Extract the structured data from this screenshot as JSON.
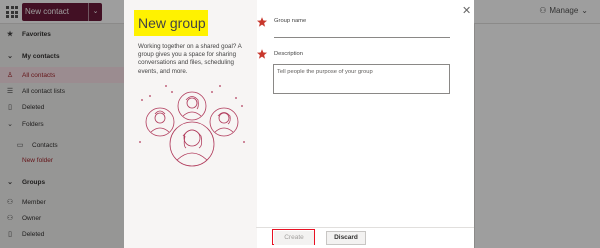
{
  "app": {
    "new_contact_label": "New contact",
    "manage_label": "Manage",
    "nav": {
      "favorites": "Favorites",
      "my_contacts": "My contacts",
      "all_contacts": "All contacts",
      "all_contact_lists": "All contact lists",
      "deleted": "Deleted",
      "folders": "Folders",
      "contacts": "Contacts",
      "new_folder": "New folder",
      "groups": "Groups",
      "member": "Member",
      "owner": "Owner",
      "groups_deleted": "Deleted"
    }
  },
  "modal": {
    "title": "New group",
    "blurb": "Working together on a shared goal? A group gives you a space for sharing conversations and files, scheduling events, and more.",
    "group_name_label": "Group name",
    "description_label": "Description",
    "description_placeholder": "Tell people the purpose of your group",
    "create_label": "Create",
    "discard_label": "Discard",
    "close_icon": "close-icon"
  },
  "colors": {
    "brand": "#6b1a3a",
    "highlight": "#fff200",
    "annotation_red": "#e81123",
    "star": "#c8372c"
  }
}
